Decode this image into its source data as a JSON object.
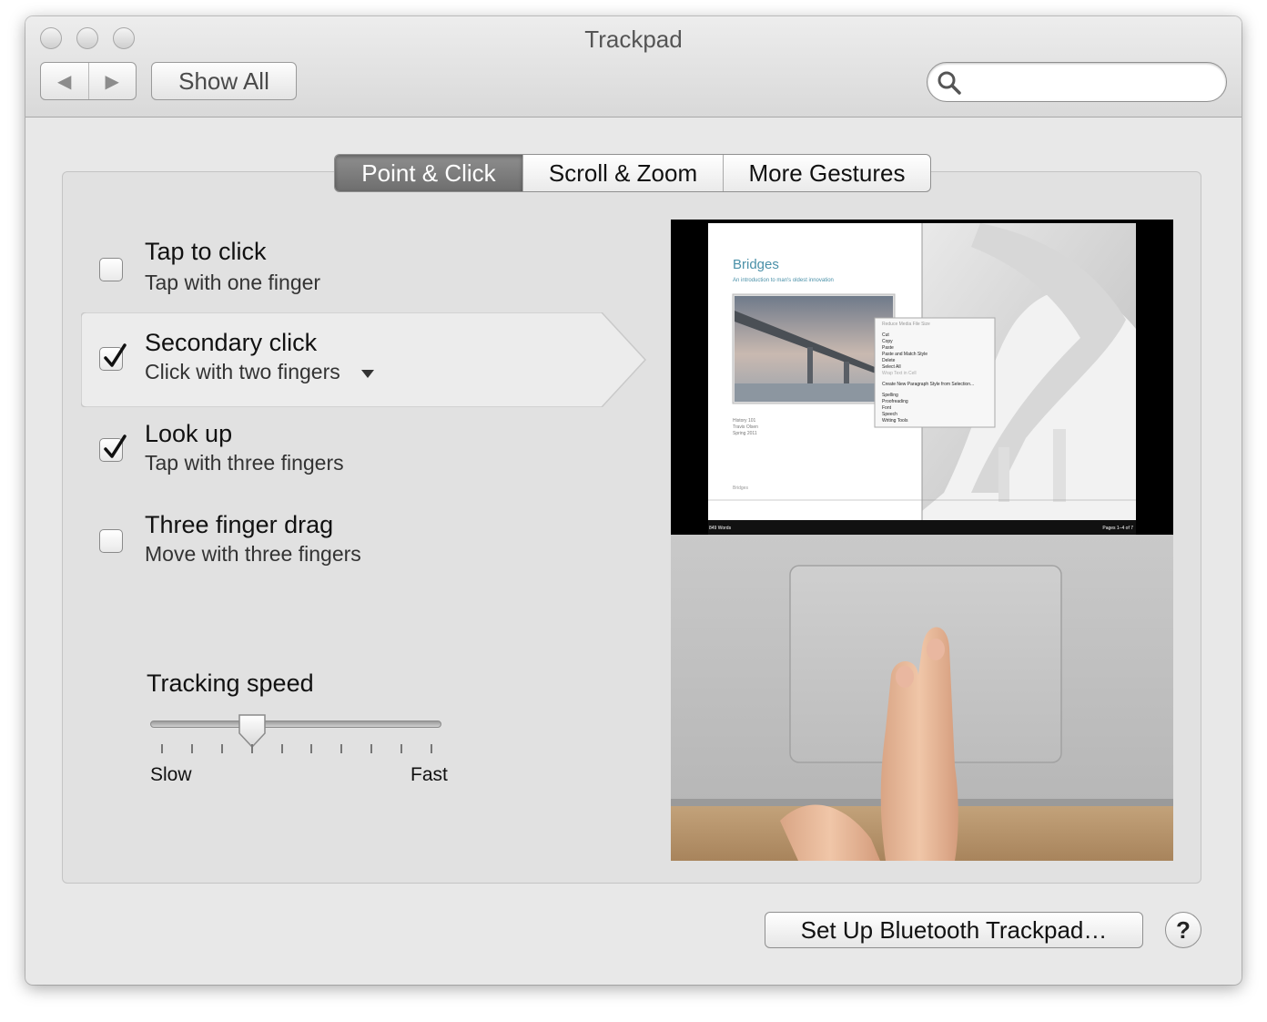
{
  "window": {
    "title": "Trackpad"
  },
  "toolbar": {
    "back_label": "◀",
    "forward_label": "▶",
    "show_all_label": "Show All",
    "search_placeholder": ""
  },
  "tabs": [
    {
      "label": "Point & Click",
      "active": true
    },
    {
      "label": "Scroll & Zoom",
      "active": false
    },
    {
      "label": "More Gestures",
      "active": false
    }
  ],
  "options": [
    {
      "title": "Tap to click",
      "subtitle": "Tap with one finger",
      "checked": false
    },
    {
      "title": "Secondary click",
      "subtitle": "Click with two fingers",
      "checked": true,
      "has_menu": true
    },
    {
      "title": "Look up",
      "subtitle": "Tap with three fingers",
      "checked": true
    },
    {
      "title": "Three finger drag",
      "subtitle": "Move with three fingers",
      "checked": false
    }
  ],
  "tracking": {
    "label": "Tracking speed",
    "min_label": "Slow",
    "max_label": "Fast",
    "value_fraction": 0.35,
    "ticks": 10
  },
  "preview": {
    "doc_title": "Bridges",
    "doc_subtitle": "An introduction to man's oldest innovation",
    "doc_meta": [
      "History 101",
      "Travis Olsen",
      "Spring 2011"
    ],
    "footer_left": "849 Words",
    "footer_right": "Pages 1–4 of 7",
    "page_footer": "Bridges",
    "menu_header": "Reduce Media File Size",
    "menu_items": [
      "Cut",
      "Copy",
      "Paste",
      "Paste and Match Style",
      "Delete",
      "Select All",
      "Wrap Text in Cell",
      "Create New Paragraph Style from Selection...",
      "Spelling",
      "Proofreading",
      "Font",
      "Speech",
      "Writing Tools"
    ]
  },
  "footer": {
    "bluetooth_label": "Set Up Bluetooth Trackpad…",
    "help_label": "?"
  },
  "colors": {
    "tab_active": "#7a7a7a",
    "doc_title": "#4a90a8",
    "window_bg": "#e8e8e8"
  }
}
